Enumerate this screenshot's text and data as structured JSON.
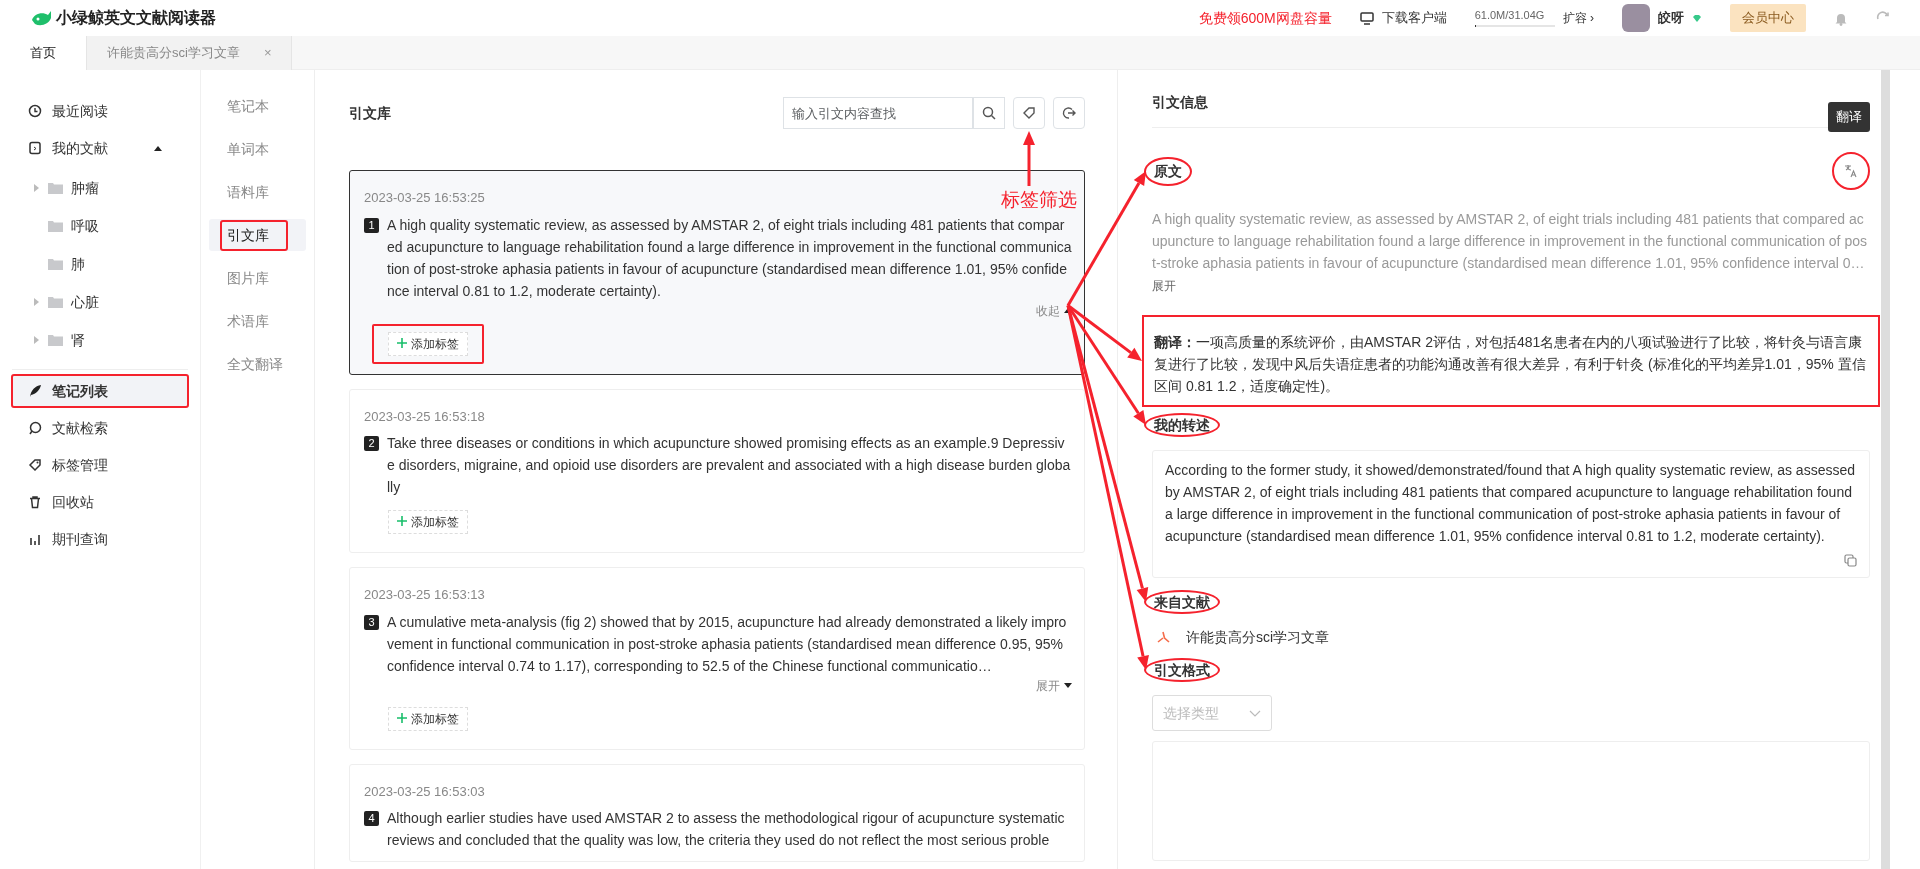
{
  "app": {
    "title": "小绿鲸英文文献阅读器"
  },
  "topbar": {
    "promo": "免费领600M网盘容量",
    "download": "下载客户端",
    "storage": {
      "reading": "61.0M/31.04G",
      "level": 0.02
    },
    "expand": "扩容 ›",
    "user": "皎呀",
    "member": "会员中心"
  },
  "tabs": [
    {
      "label": "首页",
      "selected": true
    },
    {
      "label": "许能贵高分sci学习文章",
      "selected": false,
      "close": "×"
    }
  ],
  "sidebar": {
    "items": [
      {
        "kind": "link",
        "label": "最近阅读",
        "selected": false,
        "annotated": false
      },
      {
        "kind": "group",
        "label": "我的文献",
        "expanded": true,
        "children": [
          {
            "label": "肿瘤",
            "has_children": true
          },
          {
            "label": "呼吸",
            "has_children": false
          },
          {
            "label": "肺",
            "has_children": false
          },
          {
            "label": "心脏",
            "has_children": true
          },
          {
            "label": "肾",
            "has_children": true
          }
        ]
      },
      {
        "kind": "link",
        "label": "笔记列表",
        "selected": true,
        "annotated": true
      },
      {
        "kind": "link",
        "label": "文献检索",
        "selected": false,
        "annotated": false
      },
      {
        "kind": "link",
        "label": "标签管理",
        "selected": false,
        "annotated": false
      },
      {
        "kind": "link",
        "label": "回收站",
        "selected": false,
        "annotated": false
      },
      {
        "kind": "link",
        "label": "期刊查询",
        "selected": false,
        "annotated": false
      }
    ]
  },
  "subnav": {
    "items": [
      {
        "label": "笔记本",
        "selected": false,
        "annotated": false
      },
      {
        "label": "单词本",
        "selected": false,
        "annotated": false
      },
      {
        "label": "语料库",
        "selected": false,
        "annotated": false
      },
      {
        "label": "引文库",
        "selected": true,
        "annotated": true
      },
      {
        "label": "图片库",
        "selected": false,
        "annotated": false
      },
      {
        "label": "术语库",
        "selected": false,
        "annotated": false
      },
      {
        "label": "全文翻译",
        "selected": false,
        "annotated": false
      }
    ]
  },
  "citations": {
    "title": "引文库",
    "search": {
      "placeholder": "输入引文内容查找"
    },
    "tag_filter_note": "标签筛选",
    "items": [
      {
        "index": "1",
        "time": "2023-03-25 16:53:25",
        "text": "A high quality systematic review, as assessed by AMSTAR 2, of eight trials including 481 patients that compared acupuncture to language rehabilitation found a large difference in improvement in the functional communication of post-stroke aphasia patients in favour of acupuncture (standardised mean difference 1.01, 95% confidence interval 0.81 to 1.2, moderate certainty).",
        "selected": true,
        "toggle": "收起",
        "expanded": true,
        "add_tag": "添加标签",
        "annotated": true
      },
      {
        "index": "2",
        "time": "2023-03-25 16:53:18",
        "text": "Take three diseases or conditions in which acupuncture showed promising effects as an example.9 Depressive disorders, migraine, and opioid use disorders are prevalent and associated with a high disease burden globally",
        "selected": false,
        "add_tag": "添加标签",
        "annotated": false
      },
      {
        "index": "3",
        "time": "2023-03-25 16:53:13",
        "text": "A cumulative meta-analysis (fig 2) showed that by 2015, acupuncture had already demonstrated a likely improvement in functional communication in post-stroke aphasia patients (standardised mean difference 0.95, 95% confidence interval 0.74 to 1.17), corresponding to 52.5 of the Chinese functional communicatio…",
        "selected": false,
        "toggle": "展开",
        "expanded": false,
        "add_tag": "添加标签",
        "annotated": false
      },
      {
        "index": "4",
        "time": "2023-03-25 16:53:03",
        "text": "Although earlier studies have used AMSTAR 2 to assess the methodological rigour of acupuncture systematic reviews and concluded that the quality was low, the criteria they used do not reflect the most serious proble",
        "selected": false
      }
    ]
  },
  "detail": {
    "title": "引文信息",
    "tooltip": "翻译",
    "translate_annotated": true,
    "sections": [
      {
        "kind": "original",
        "heading": "原文",
        "annotated": true,
        "text": "A high quality systematic review, as assessed by AMSTAR 2, of eight trials including 481 patients that compared acupuncture to language rehabilitation found a large difference in improvement in the functional communication of post-stroke aphasia patients in favour of acupuncture (standardised mean difference 1.01, 95% confidence interval 0…",
        "toggle": "展开"
      },
      {
        "kind": "translation",
        "annotated": true,
        "text": "**翻译：**一项高质量的系统评价，由AMSTAR 2评估，对包括481名患者在内的八项试验进行了比较，将针灸与语言康复进行了比较，发现中风后失语症患者的功能沟通改善有很大差异，有利于针灸 (标准化的平均差异1.01，95% 置信区间 0.81 1.2，适度确定性)。"
      },
      {
        "kind": "rewrite",
        "heading": "我的转述",
        "annotated": true,
        "text": "According to the former study, it showed/demonstrated/found that A high quality systematic review, as assessed by AMSTAR 2, of eight trials including 481 patients that compared acupuncture to language rehabilitation found a large difference in improvement in the functional communication of post-stroke aphasia patients in favour of acupuncture (standardised mean difference 1.01, 95% confidence interval 0.81 to 1.2, moderate certainty)."
      },
      {
        "kind": "source",
        "heading": "来自文献",
        "annotated": true,
        "file": "许能贵高分sci学习文章"
      },
      {
        "kind": "format",
        "heading": "引文格式",
        "annotated": true,
        "placeholder": "选择类型"
      }
    ]
  }
}
